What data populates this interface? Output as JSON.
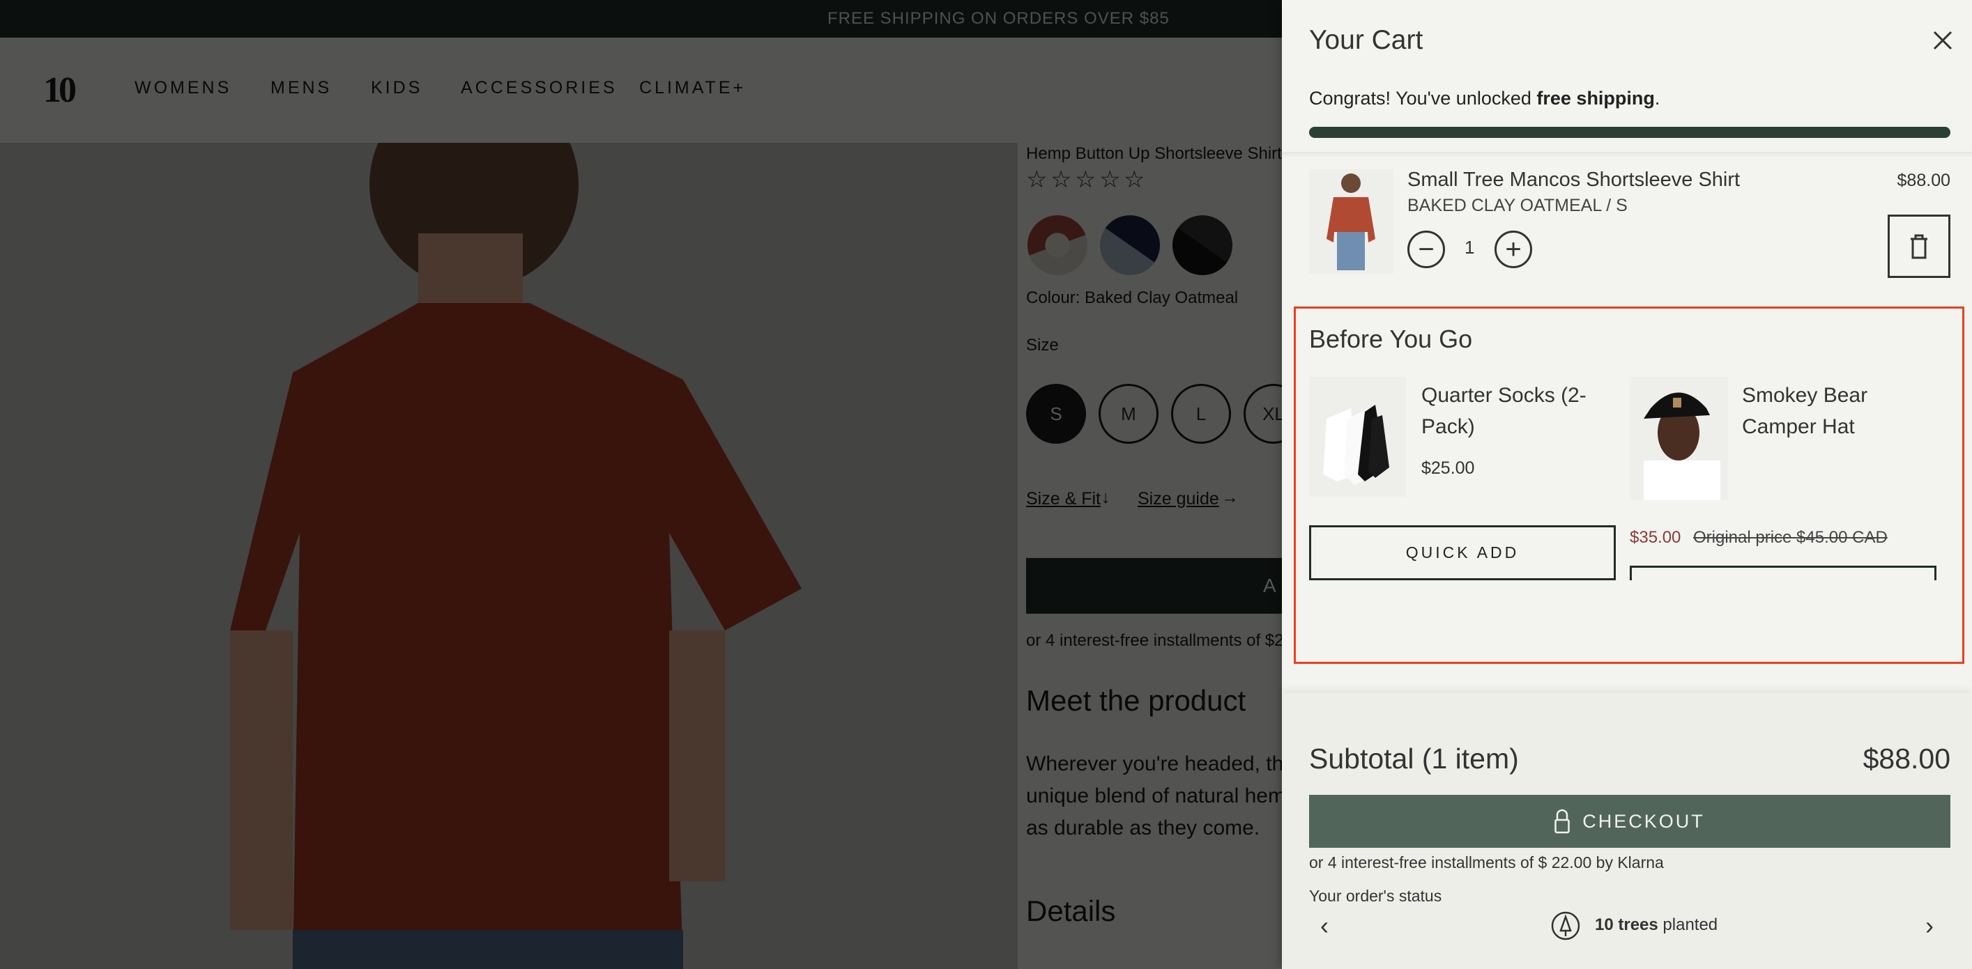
{
  "banner": {
    "text": "FREE SHIPPING ON ORDERS OVER $85"
  },
  "nav": {
    "logo": "10",
    "items": [
      {
        "label": "WOMENS"
      },
      {
        "label": "MENS"
      },
      {
        "label": "KIDS"
      },
      {
        "label": "ACCESSORIES"
      },
      {
        "label": "CLIMATE+"
      }
    ]
  },
  "product": {
    "title": "Hemp Button Up Shortsleeve Shirt",
    "rating_stars": 5,
    "rating_value": 0,
    "swatches": [
      {
        "colors": [
          "#a4473a",
          "#d9d5cc"
        ]
      },
      {
        "colors": [
          "#1b2340",
          "#a8b4c8"
        ]
      },
      {
        "colors": [
          "#111111",
          "#333333"
        ]
      }
    ],
    "colour_label": "Colour: Baked Clay Oatmeal",
    "size_label": "Size",
    "sizes": [
      {
        "label": "S",
        "selected": true
      },
      {
        "label": "M"
      },
      {
        "label": "L"
      },
      {
        "label": "XL"
      }
    ],
    "size_fit_link": "Size & Fit",
    "size_guide_link": "Size guide",
    "add_button": "A",
    "installments": "or 4 interest-free installments of $2",
    "meet_heading": "Meet the product",
    "description": [
      "Wherever you're headed, thi",
      "unique blend of natural hem",
      "as durable as they come."
    ],
    "details_heading": "Details"
  },
  "cart": {
    "title": "Your Cart",
    "congrats_prefix": "Congrats! You've unlocked ",
    "congrats_bold": "free shipping",
    "congrats_suffix": ".",
    "shipping_progress": 1.0,
    "colors": {
      "progress": "#2a4034",
      "checkout": "#52655a",
      "sale": "#8a3a34",
      "highlight": "#e8401f"
    },
    "item": {
      "name": "Small Tree Mancos Shortsleeve Shirt",
      "variant": "BAKED CLAY OATMEAL / S",
      "quantity": "1",
      "price": "$88.00"
    },
    "upsell": {
      "heading": "Before You Go",
      "products": [
        {
          "name": "Quarter Socks (2-Pack)",
          "price": "$25.00",
          "button": "QUICK ADD"
        },
        {
          "name": "Smokey Bear Camper Hat",
          "sale_price": "$35.00",
          "original_price": "Original price $45.00 CAD"
        }
      ]
    },
    "subtotal_label": "Subtotal (1 item)",
    "subtotal_value": "$88.00",
    "checkout_label": "CHECKOUT",
    "klarna": "or 4 interest-free installments of $ 22.00 by Klarna",
    "order_status_label": "Your order's status",
    "impact_bold": "10 trees",
    "impact_rest": " planted"
  }
}
